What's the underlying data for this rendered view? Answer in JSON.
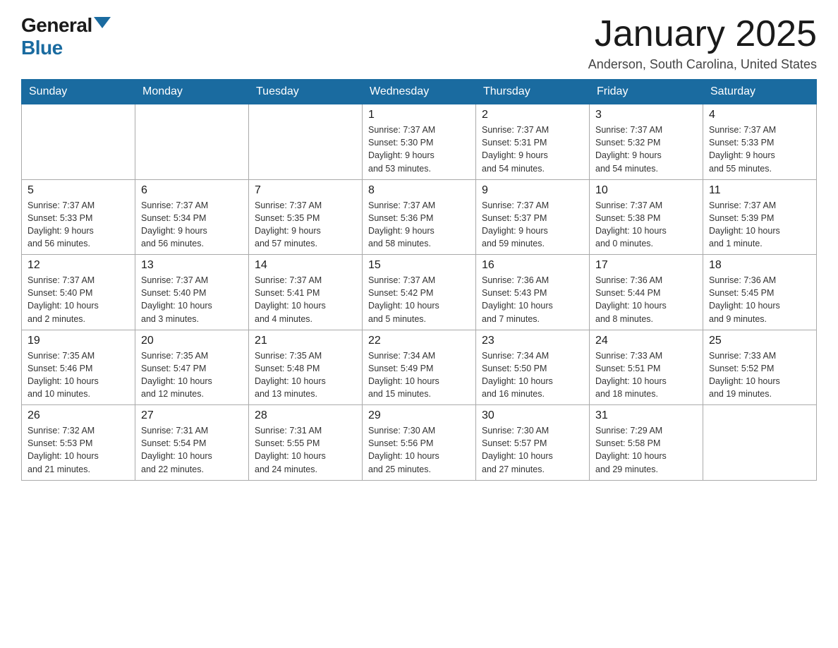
{
  "logo": {
    "general": "General",
    "blue": "Blue"
  },
  "title": "January 2025",
  "location": "Anderson, South Carolina, United States",
  "days_of_week": [
    "Sunday",
    "Monday",
    "Tuesday",
    "Wednesday",
    "Thursday",
    "Friday",
    "Saturday"
  ],
  "weeks": [
    [
      {
        "day": "",
        "info": ""
      },
      {
        "day": "",
        "info": ""
      },
      {
        "day": "",
        "info": ""
      },
      {
        "day": "1",
        "info": "Sunrise: 7:37 AM\nSunset: 5:30 PM\nDaylight: 9 hours\nand 53 minutes."
      },
      {
        "day": "2",
        "info": "Sunrise: 7:37 AM\nSunset: 5:31 PM\nDaylight: 9 hours\nand 54 minutes."
      },
      {
        "day": "3",
        "info": "Sunrise: 7:37 AM\nSunset: 5:32 PM\nDaylight: 9 hours\nand 54 minutes."
      },
      {
        "day": "4",
        "info": "Sunrise: 7:37 AM\nSunset: 5:33 PM\nDaylight: 9 hours\nand 55 minutes."
      }
    ],
    [
      {
        "day": "5",
        "info": "Sunrise: 7:37 AM\nSunset: 5:33 PM\nDaylight: 9 hours\nand 56 minutes."
      },
      {
        "day": "6",
        "info": "Sunrise: 7:37 AM\nSunset: 5:34 PM\nDaylight: 9 hours\nand 56 minutes."
      },
      {
        "day": "7",
        "info": "Sunrise: 7:37 AM\nSunset: 5:35 PM\nDaylight: 9 hours\nand 57 minutes."
      },
      {
        "day": "8",
        "info": "Sunrise: 7:37 AM\nSunset: 5:36 PM\nDaylight: 9 hours\nand 58 minutes."
      },
      {
        "day": "9",
        "info": "Sunrise: 7:37 AM\nSunset: 5:37 PM\nDaylight: 9 hours\nand 59 minutes."
      },
      {
        "day": "10",
        "info": "Sunrise: 7:37 AM\nSunset: 5:38 PM\nDaylight: 10 hours\nand 0 minutes."
      },
      {
        "day": "11",
        "info": "Sunrise: 7:37 AM\nSunset: 5:39 PM\nDaylight: 10 hours\nand 1 minute."
      }
    ],
    [
      {
        "day": "12",
        "info": "Sunrise: 7:37 AM\nSunset: 5:40 PM\nDaylight: 10 hours\nand 2 minutes."
      },
      {
        "day": "13",
        "info": "Sunrise: 7:37 AM\nSunset: 5:40 PM\nDaylight: 10 hours\nand 3 minutes."
      },
      {
        "day": "14",
        "info": "Sunrise: 7:37 AM\nSunset: 5:41 PM\nDaylight: 10 hours\nand 4 minutes."
      },
      {
        "day": "15",
        "info": "Sunrise: 7:37 AM\nSunset: 5:42 PM\nDaylight: 10 hours\nand 5 minutes."
      },
      {
        "day": "16",
        "info": "Sunrise: 7:36 AM\nSunset: 5:43 PM\nDaylight: 10 hours\nand 7 minutes."
      },
      {
        "day": "17",
        "info": "Sunrise: 7:36 AM\nSunset: 5:44 PM\nDaylight: 10 hours\nand 8 minutes."
      },
      {
        "day": "18",
        "info": "Sunrise: 7:36 AM\nSunset: 5:45 PM\nDaylight: 10 hours\nand 9 minutes."
      }
    ],
    [
      {
        "day": "19",
        "info": "Sunrise: 7:35 AM\nSunset: 5:46 PM\nDaylight: 10 hours\nand 10 minutes."
      },
      {
        "day": "20",
        "info": "Sunrise: 7:35 AM\nSunset: 5:47 PM\nDaylight: 10 hours\nand 12 minutes."
      },
      {
        "day": "21",
        "info": "Sunrise: 7:35 AM\nSunset: 5:48 PM\nDaylight: 10 hours\nand 13 minutes."
      },
      {
        "day": "22",
        "info": "Sunrise: 7:34 AM\nSunset: 5:49 PM\nDaylight: 10 hours\nand 15 minutes."
      },
      {
        "day": "23",
        "info": "Sunrise: 7:34 AM\nSunset: 5:50 PM\nDaylight: 10 hours\nand 16 minutes."
      },
      {
        "day": "24",
        "info": "Sunrise: 7:33 AM\nSunset: 5:51 PM\nDaylight: 10 hours\nand 18 minutes."
      },
      {
        "day": "25",
        "info": "Sunrise: 7:33 AM\nSunset: 5:52 PM\nDaylight: 10 hours\nand 19 minutes."
      }
    ],
    [
      {
        "day": "26",
        "info": "Sunrise: 7:32 AM\nSunset: 5:53 PM\nDaylight: 10 hours\nand 21 minutes."
      },
      {
        "day": "27",
        "info": "Sunrise: 7:31 AM\nSunset: 5:54 PM\nDaylight: 10 hours\nand 22 minutes."
      },
      {
        "day": "28",
        "info": "Sunrise: 7:31 AM\nSunset: 5:55 PM\nDaylight: 10 hours\nand 24 minutes."
      },
      {
        "day": "29",
        "info": "Sunrise: 7:30 AM\nSunset: 5:56 PM\nDaylight: 10 hours\nand 25 minutes."
      },
      {
        "day": "30",
        "info": "Sunrise: 7:30 AM\nSunset: 5:57 PM\nDaylight: 10 hours\nand 27 minutes."
      },
      {
        "day": "31",
        "info": "Sunrise: 7:29 AM\nSunset: 5:58 PM\nDaylight: 10 hours\nand 29 minutes."
      },
      {
        "day": "",
        "info": ""
      }
    ]
  ]
}
